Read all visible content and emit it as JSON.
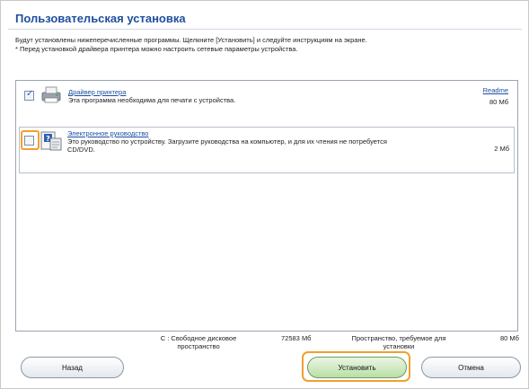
{
  "window": {
    "title": "Пользовательская установка",
    "description_line1": "Будут установлены нижеперечисленные программы. Щелкните [Установить] и следуйте инструкциям на экране.",
    "description_line2": "* Перед установкой драйвера принтера можно настроить сетевые параметры устройства."
  },
  "items": [
    {
      "name": "Драйвер принтера",
      "description": "Эта программа необходима для печати с устройства.",
      "readme": "Readme",
      "size": "80 Мб",
      "checked": true,
      "icon": "printer-icon"
    },
    {
      "name": "Электронное руководство",
      "description_line1": "Это руководство по устройству. Загрузите руководства на компьютер, и для их чтения не потребуется",
      "description_line2": "CD/DVD.",
      "size": "2 Мб",
      "checked": false,
      "icon": "manual-help-icon"
    }
  ],
  "disk": {
    "free_label_line1": "C : Свободное дисковое",
    "free_label_line2": "пространство",
    "free_value": "72583 Мб",
    "required_label_line1": "Пространство, требуемое для",
    "required_label_line2": "установки",
    "required_value": "80 Мб"
  },
  "buttons": {
    "back": "Назад",
    "install": "Установить",
    "cancel": "Отмена"
  },
  "colors": {
    "title": "#1f4e9e",
    "link": "#1c4fa3",
    "highlight": "#f0a030",
    "install_button": "#b9dfa6"
  }
}
